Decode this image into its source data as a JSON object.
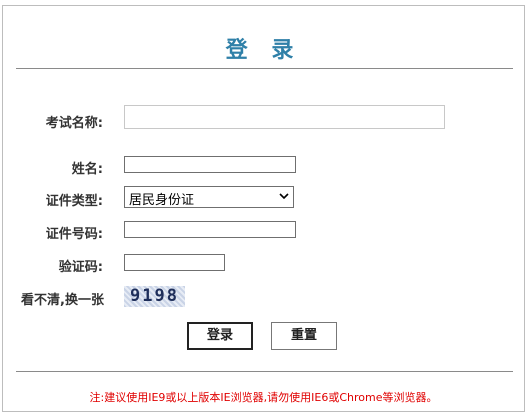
{
  "title": "登 录",
  "form": {
    "exam_name_label": "考试名称:",
    "exam_name_value": "",
    "name_label": "姓名:",
    "name_value": "",
    "id_type_label": "证件类型:",
    "id_type_value": "居民身份证",
    "id_number_label": "证件号码:",
    "id_number_value": "",
    "captcha_label": "验证码:",
    "captcha_value": "",
    "refresh_label": "看不清,换一张",
    "captcha_text": "9198"
  },
  "buttons": {
    "login": "登录",
    "reset": "重置"
  },
  "notice": "注:建议使用IE9或以上版本IE浏览器,请勿使用IE6或Chrome等浏览器。"
}
